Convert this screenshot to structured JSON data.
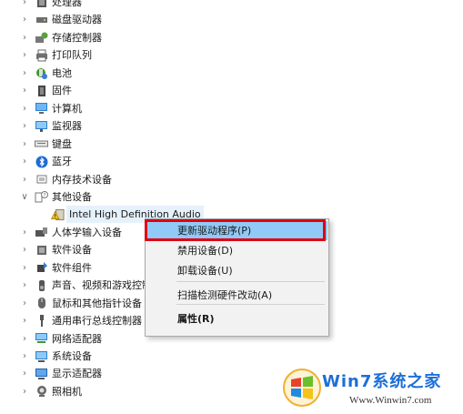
{
  "device_tree": {
    "items": [
      {
        "label": "处理器",
        "chevron": "right",
        "icon": "processor-icon"
      },
      {
        "label": "磁盘驱动器",
        "chevron": "right",
        "icon": "disk-drive-icon"
      },
      {
        "label": "存储控制器",
        "chevron": "right",
        "icon": "storage-controller-icon"
      },
      {
        "label": "打印队列",
        "chevron": "right",
        "icon": "print-queue-icon"
      },
      {
        "label": "电池",
        "chevron": "right",
        "icon": "battery-icon"
      },
      {
        "label": "固件",
        "chevron": "right",
        "icon": "firmware-icon"
      },
      {
        "label": "计算机",
        "chevron": "right",
        "icon": "computer-icon"
      },
      {
        "label": "监视器",
        "chevron": "right",
        "icon": "monitor-icon"
      },
      {
        "label": "键盘",
        "chevron": "right",
        "icon": "keyboard-icon"
      },
      {
        "label": "蓝牙",
        "chevron": "right",
        "icon": "bluetooth-icon"
      },
      {
        "label": "内存技术设备",
        "chevron": "right",
        "icon": "memory-device-icon"
      },
      {
        "label": "其他设备",
        "chevron": "down",
        "icon": "unknown-device-icon"
      },
      {
        "label": "Intel High Definition Audio",
        "child": true,
        "icon": "warning-device-icon"
      },
      {
        "label": "人体学输入设备",
        "chevron": "right",
        "icon": "hid-icon"
      },
      {
        "label": "软件设备",
        "chevron": "right",
        "icon": "software-device-icon"
      },
      {
        "label": "软件组件",
        "chevron": "right",
        "icon": "software-component-icon"
      },
      {
        "label": "声音、视频和游戏控制器",
        "chevron": "right",
        "icon": "sound-icon"
      },
      {
        "label": "鼠标和其他指针设备",
        "chevron": "right",
        "icon": "mouse-icon"
      },
      {
        "label": "通用串行总线控制器",
        "chevron": "right",
        "icon": "usb-icon"
      },
      {
        "label": "网络适配器",
        "chevron": "right",
        "icon": "network-adapter-icon"
      },
      {
        "label": "系统设备",
        "chevron": "right",
        "icon": "system-device-icon"
      },
      {
        "label": "显示适配器",
        "chevron": "right",
        "icon": "display-adapter-icon"
      },
      {
        "label": "照相机",
        "chevron": "right",
        "icon": "camera-icon"
      }
    ]
  },
  "context_menu": {
    "items": [
      {
        "label": "更新驱动程序(P)",
        "state": "hover"
      },
      {
        "label": "禁用设备(D)"
      },
      {
        "label": "卸载设备(U)"
      },
      {
        "separator": true
      },
      {
        "label": "扫描检测硬件改动(A)"
      },
      {
        "separator": true
      },
      {
        "label": "属性(R)",
        "bold": true
      }
    ]
  },
  "watermark": {
    "brand": "Win7系统之家",
    "url": "Www.Winwin7.com"
  },
  "colors": {
    "highlight_border": "#e00012",
    "menu_hover": "#91c9f7",
    "menu_background": "#f2f2f2",
    "watermark_blue": "#1d6fd8"
  }
}
